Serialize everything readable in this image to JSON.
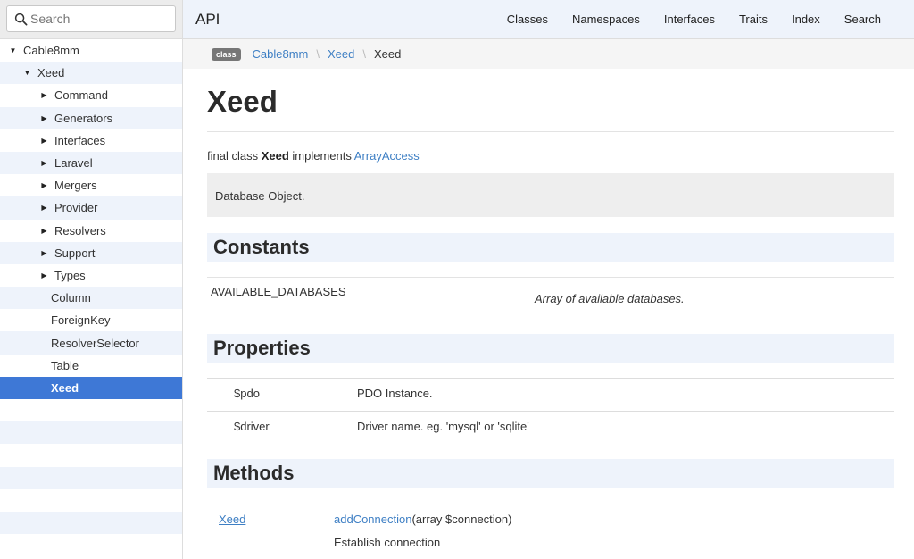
{
  "sidebar": {
    "search_placeholder": "Search",
    "tree": [
      {
        "label": "Cable8mm",
        "level": 0,
        "expanded": true
      },
      {
        "label": "Xeed",
        "level": 1,
        "expanded": true
      },
      {
        "label": "Command",
        "level": 2,
        "expanded": false
      },
      {
        "label": "Generators",
        "level": 2,
        "expanded": false
      },
      {
        "label": "Interfaces",
        "level": 2,
        "expanded": false
      },
      {
        "label": "Laravel",
        "level": 2,
        "expanded": false
      },
      {
        "label": "Mergers",
        "level": 2,
        "expanded": false
      },
      {
        "label": "Provider",
        "level": 2,
        "expanded": false
      },
      {
        "label": "Resolvers",
        "level": 2,
        "expanded": false
      },
      {
        "label": "Support",
        "level": 2,
        "expanded": false
      },
      {
        "label": "Types",
        "level": 2,
        "expanded": false
      },
      {
        "label": "Column",
        "level": 2,
        "leaf": true
      },
      {
        "label": "ForeignKey",
        "level": 2,
        "leaf": true
      },
      {
        "label": "ResolverSelector",
        "level": 2,
        "leaf": true
      },
      {
        "label": "Table",
        "level": 2,
        "leaf": true
      },
      {
        "label": "Xeed",
        "level": 2,
        "leaf": true,
        "selected": true
      }
    ]
  },
  "header": {
    "brand": "API",
    "nav": [
      "Classes",
      "Namespaces",
      "Interfaces",
      "Traits",
      "Index",
      "Search"
    ]
  },
  "breadcrumb": {
    "badge": "class",
    "items": [
      "Cable8mm",
      "Xeed"
    ],
    "current": "Xeed",
    "separator": "\\"
  },
  "page": {
    "title": "Xeed",
    "declaration": {
      "prefix": "final class",
      "name": "Xeed",
      "middle": "implements",
      "interface": "ArrayAccess"
    },
    "description": "Database Object."
  },
  "constants": {
    "heading": "Constants",
    "items": [
      {
        "name": "AVAILABLE_DATABASES",
        "description": "Array of available databases."
      }
    ]
  },
  "properties": {
    "heading": "Properties",
    "items": [
      {
        "name": "$pdo",
        "description": "PDO Instance."
      },
      {
        "name": "$driver",
        "description": "Driver name. eg. 'mysql' or 'sqlite'"
      }
    ]
  },
  "methods": {
    "heading": "Methods",
    "items": [
      {
        "return_type": "Xeed",
        "name": "addConnection",
        "args": "(array $connection)",
        "description": "Establish connection"
      }
    ]
  },
  "colors": {
    "accent": "#3e78d6",
    "link": "#3e7fc4",
    "stripe": "#eef3fb"
  }
}
